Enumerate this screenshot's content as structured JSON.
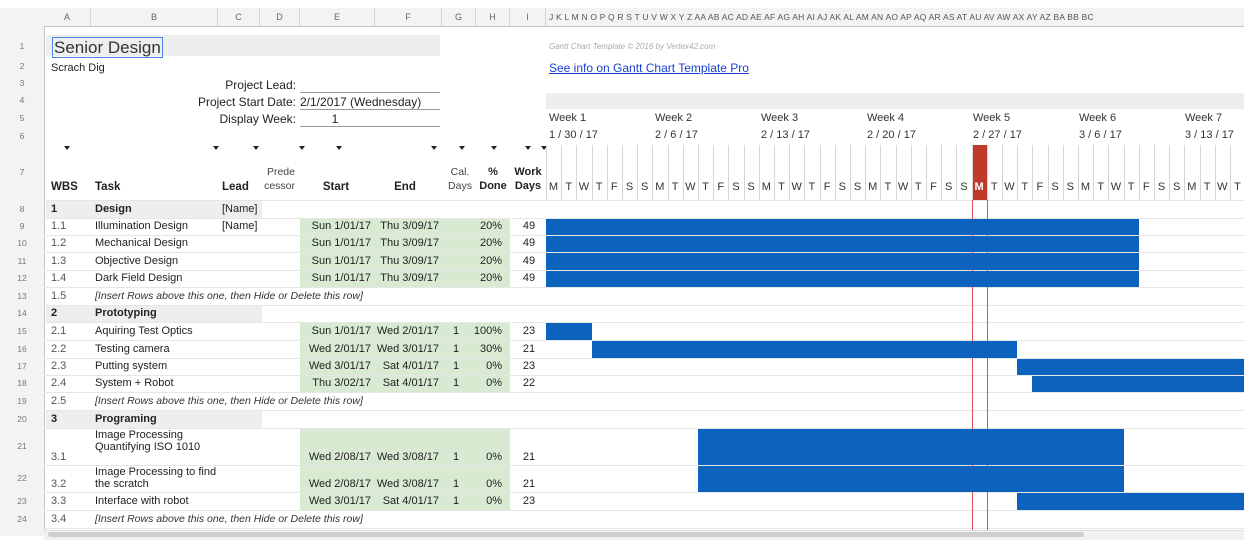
{
  "column_headers": [
    "A",
    "B",
    "C",
    "D",
    "E",
    "F",
    "G",
    "H",
    "I"
  ],
  "gantt_column_letters": "J K L M N O P Q R S T U V W X Y Z AA AB AC AD AE AF AG AH AI AJ AK AL AM AN AO AP AQ AR AS AT AU AV AW AX AY AZ BA BB BC",
  "row_numbers": [
    "1",
    "2",
    "3",
    "4",
    "5",
    "6",
    "7",
    "8",
    "9",
    "10",
    "11",
    "12",
    "13",
    "14",
    "15",
    "16",
    "17",
    "18",
    "19",
    "20",
    "21",
    "22",
    "23",
    "24"
  ],
  "title": "Senior Design",
  "subtitle": "Scrach Dig",
  "template_credit": "Gantt Chart Template © 2016 by Vertex42.com",
  "template_link": "See info on Gantt Chart Template Pro",
  "project": {
    "lead_label": "Project Lead:",
    "lead_value": "",
    "start_label": "Project Start Date:",
    "start_value": "2/1/2017 (Wednesday)",
    "week_label": "Display Week:",
    "week_value": "1"
  },
  "headers": {
    "wbs": "WBS",
    "task": "Task",
    "lead": "Lead",
    "pred_1": "Prede",
    "pred_2": "cessor",
    "start": "Start",
    "end": "End",
    "cal_1": "Cal.",
    "cal_2": "Days",
    "done_1": "%",
    "done_2": "Done",
    "work_1": "Work",
    "work_2": "Days"
  },
  "weeks": [
    {
      "label": "Week 1",
      "date": "1 / 30 / 17"
    },
    {
      "label": "Week 2",
      "date": "2 / 6 / 17"
    },
    {
      "label": "Week 3",
      "date": "2 / 13 / 17"
    },
    {
      "label": "Week 4",
      "date": "2 / 20 / 17"
    },
    {
      "label": "Week 5",
      "date": "2 / 27 / 17"
    },
    {
      "label": "Week 6",
      "date": "3 / 6 / 17"
    },
    {
      "label": "Week 7",
      "date": "3 / 13 / 17"
    }
  ],
  "day_letters": [
    "M",
    "T",
    "W",
    "T",
    "F",
    "S",
    "S"
  ],
  "today_letter": "M",
  "rows": [
    {
      "wbs": "1",
      "task": "Design",
      "lead": "[Name]",
      "kind": "section"
    },
    {
      "wbs": "1.1",
      "task": "Illumination Design",
      "lead": "[Name]",
      "start": "Sun 1/01/17",
      "end": "Thu 3/09/17",
      "cal": "",
      "done": "20%",
      "work": "49"
    },
    {
      "wbs": "1.2",
      "task": "Mechanical Design",
      "lead": "",
      "start": "Sun 1/01/17",
      "end": "Thu 3/09/17",
      "cal": "",
      "done": "20%",
      "work": "49"
    },
    {
      "wbs": "1.3",
      "task": "Objective Design",
      "lead": "",
      "start": "Sun 1/01/17",
      "end": "Thu 3/09/17",
      "cal": "",
      "done": "20%",
      "work": "49"
    },
    {
      "wbs": "1.4",
      "task": "Dark Field Design",
      "lead": "",
      "start": "Sun 1/01/17",
      "end": "Thu 3/09/17",
      "cal": "",
      "done": "20%",
      "work": "49"
    },
    {
      "wbs": "1.5",
      "task": "[Insert Rows above this one, then Hide or Delete this row]",
      "kind": "insert"
    },
    {
      "wbs": "2",
      "task": "Prototyping",
      "kind": "section"
    },
    {
      "wbs": "2.1",
      "task": "Aquiring Test Optics",
      "lead": "",
      "start": "Sun 1/01/17",
      "end": "Wed 2/01/17",
      "cal": "1",
      "done": "100%",
      "work": "23"
    },
    {
      "wbs": "2.2",
      "task": "Testing camera",
      "lead": "",
      "start": "Wed 2/01/17",
      "end": "Wed 3/01/17",
      "cal": "1",
      "done": "30%",
      "work": "21"
    },
    {
      "wbs": "2.3",
      "task": "Putting system",
      "lead": "",
      "start": "Wed 3/01/17",
      "end": "Sat 4/01/17",
      "cal": "1",
      "done": "0%",
      "work": "23"
    },
    {
      "wbs": "2.4",
      "task": "System + Robot",
      "lead": "",
      "start": "Thu 3/02/17",
      "end": "Sat 4/01/17",
      "cal": "1",
      "done": "0%",
      "work": "22"
    },
    {
      "wbs": "2.5",
      "task": "[Insert Rows above this one, then Hide or Delete this row]",
      "kind": "insert"
    },
    {
      "wbs": "3",
      "task": "Programing",
      "kind": "section"
    },
    {
      "wbs": "3.1",
      "task": "Image Processing",
      "task2": "Quantifying ISO 1010",
      "lead": "",
      "start": "Wed 2/08/17",
      "end": "Wed 3/08/17",
      "cal": "1",
      "done": "0%",
      "work": "21"
    },
    {
      "wbs": "3.2",
      "task": "Image Processing to find",
      "task2": "the scratch",
      "lead": "",
      "start": "Wed 2/08/17",
      "end": "Wed 3/08/17",
      "cal": "1",
      "done": "0%",
      "work": "21"
    },
    {
      "wbs": "3.3",
      "task": "Interface with robot",
      "lead": "",
      "start": "Wed 3/01/17",
      "end": "Sat 4/01/17",
      "cal": "1",
      "done": "0%",
      "work": "23"
    },
    {
      "wbs": "3.4",
      "task": "[Insert Rows above this one, then Hide or Delete this row]",
      "kind": "insert"
    }
  ],
  "colors": {
    "bar": "#0b63be",
    "today": "#c0392b",
    "green_cell": "#d9ead3",
    "section_fill": "#eeeeee"
  }
}
